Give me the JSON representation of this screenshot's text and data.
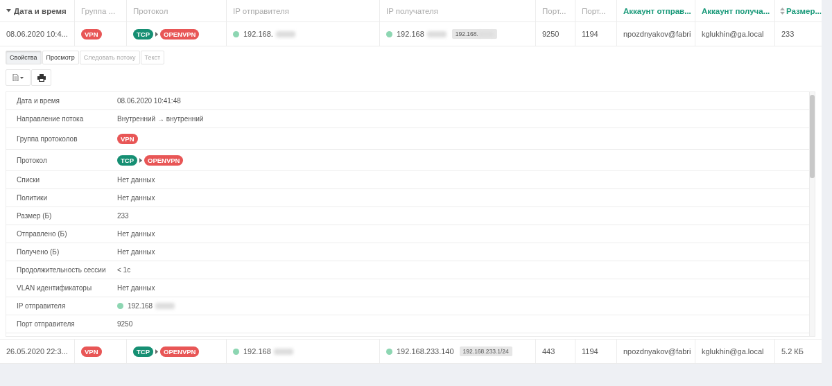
{
  "columns": [
    {
      "label": "Дата и время",
      "sortable": true,
      "sorted": true,
      "accent": false,
      "strong": true
    },
    {
      "label": "Группа ...",
      "sortable": false,
      "accent": false,
      "strong": false
    },
    {
      "label": "Протокол",
      "sortable": false,
      "accent": false,
      "strong": false
    },
    {
      "label": "IP отправителя",
      "sortable": false,
      "accent": false,
      "strong": false
    },
    {
      "label": "IP получателя",
      "sortable": false,
      "accent": false,
      "strong": false
    },
    {
      "label": "Порт...",
      "sortable": false,
      "accent": false,
      "strong": false
    },
    {
      "label": "Порт...",
      "sortable": false,
      "accent": false,
      "strong": false
    },
    {
      "label": "Аккаунт отправ...",
      "sortable": false,
      "accent": true,
      "strong": true
    },
    {
      "label": "Аккаунт получа...",
      "sortable": false,
      "accent": true,
      "strong": true
    },
    {
      "label": "Размер...",
      "sortable": true,
      "sorted": false,
      "accent": true,
      "strong": true
    }
  ],
  "rows": [
    {
      "expanded": true,
      "datetime": "08.06.2020 10:4...",
      "group": {
        "label": "VPN",
        "color": "#e85656"
      },
      "protocol": [
        {
          "label": "TCP",
          "color": "#168f73"
        },
        {
          "label": "OPENVPN",
          "color": "#e85656"
        }
      ],
      "src_ip": {
        "text": "192.168.",
        "redacted": true
      },
      "dst_ip": {
        "text": "192.168",
        "redacted": true,
        "subnet": "192.168.",
        "subnet_redacted": true
      },
      "src_port": "9250",
      "dst_port": "1194",
      "src_account": "npozdnyakov@fabri",
      "dst_account": "kglukhin@ga.local",
      "size": "233"
    },
    {
      "expanded": false,
      "datetime": "26.05.2020 22:3...",
      "group": {
        "label": "VPN",
        "color": "#e85656"
      },
      "protocol": [
        {
          "label": "TCP",
          "color": "#168f73"
        },
        {
          "label": "OPENVPN",
          "color": "#e85656"
        }
      ],
      "src_ip": {
        "text": "192.168",
        "redacted": true
      },
      "dst_ip": {
        "text": "192.168.233.140",
        "subnet": "192.168.233.1/24"
      },
      "src_port": "443",
      "dst_port": "1194",
      "src_account": "npozdnyakov@fabri",
      "dst_account": "kglukhin@ga.local",
      "size": "5.2 КБ"
    }
  ],
  "detail": {
    "tabs": [
      {
        "label": "Свойства",
        "selected": true,
        "disabled": false
      },
      {
        "label": "Просмотр",
        "selected": false,
        "disabled": false
      },
      {
        "label": "Следовать потоку",
        "selected": false,
        "disabled": true
      },
      {
        "label": "Текст",
        "selected": false,
        "disabled": true
      }
    ],
    "properties": [
      {
        "kind": "text",
        "label": "Дата и время",
        "value": "08.06.2020 10:41:48"
      },
      {
        "kind": "text",
        "label": "Направление потока",
        "value": "Внутренний → внутренний"
      },
      {
        "kind": "tags",
        "label": "Группа протоколов",
        "tags": [
          {
            "label": "VPN",
            "color": "#e85656"
          }
        ]
      },
      {
        "kind": "tags",
        "label": "Протокол",
        "tags": [
          {
            "label": "TCP",
            "color": "#168f73"
          },
          {
            "label": "OPENVPN",
            "color": "#e85656"
          }
        ]
      },
      {
        "kind": "text",
        "label": "Списки",
        "value": "Нет данных"
      },
      {
        "kind": "text",
        "label": "Политики",
        "value": "Нет данных"
      },
      {
        "kind": "text",
        "label": "Размер (Б)",
        "value": "233"
      },
      {
        "kind": "text",
        "label": "Отправлено (Б)",
        "value": "Нет данных"
      },
      {
        "kind": "text",
        "label": "Получено (Б)",
        "value": "Нет данных"
      },
      {
        "kind": "text",
        "label": "Продолжительность сессии",
        "value": "< 1с"
      },
      {
        "kind": "text",
        "label": "VLAN идентификаторы",
        "value": "Нет данных"
      },
      {
        "kind": "ip",
        "label": "IP отправителя",
        "value": "192.168",
        "redacted": true
      },
      {
        "kind": "text",
        "label": "Порт отправителя",
        "value": "9250"
      }
    ]
  }
}
